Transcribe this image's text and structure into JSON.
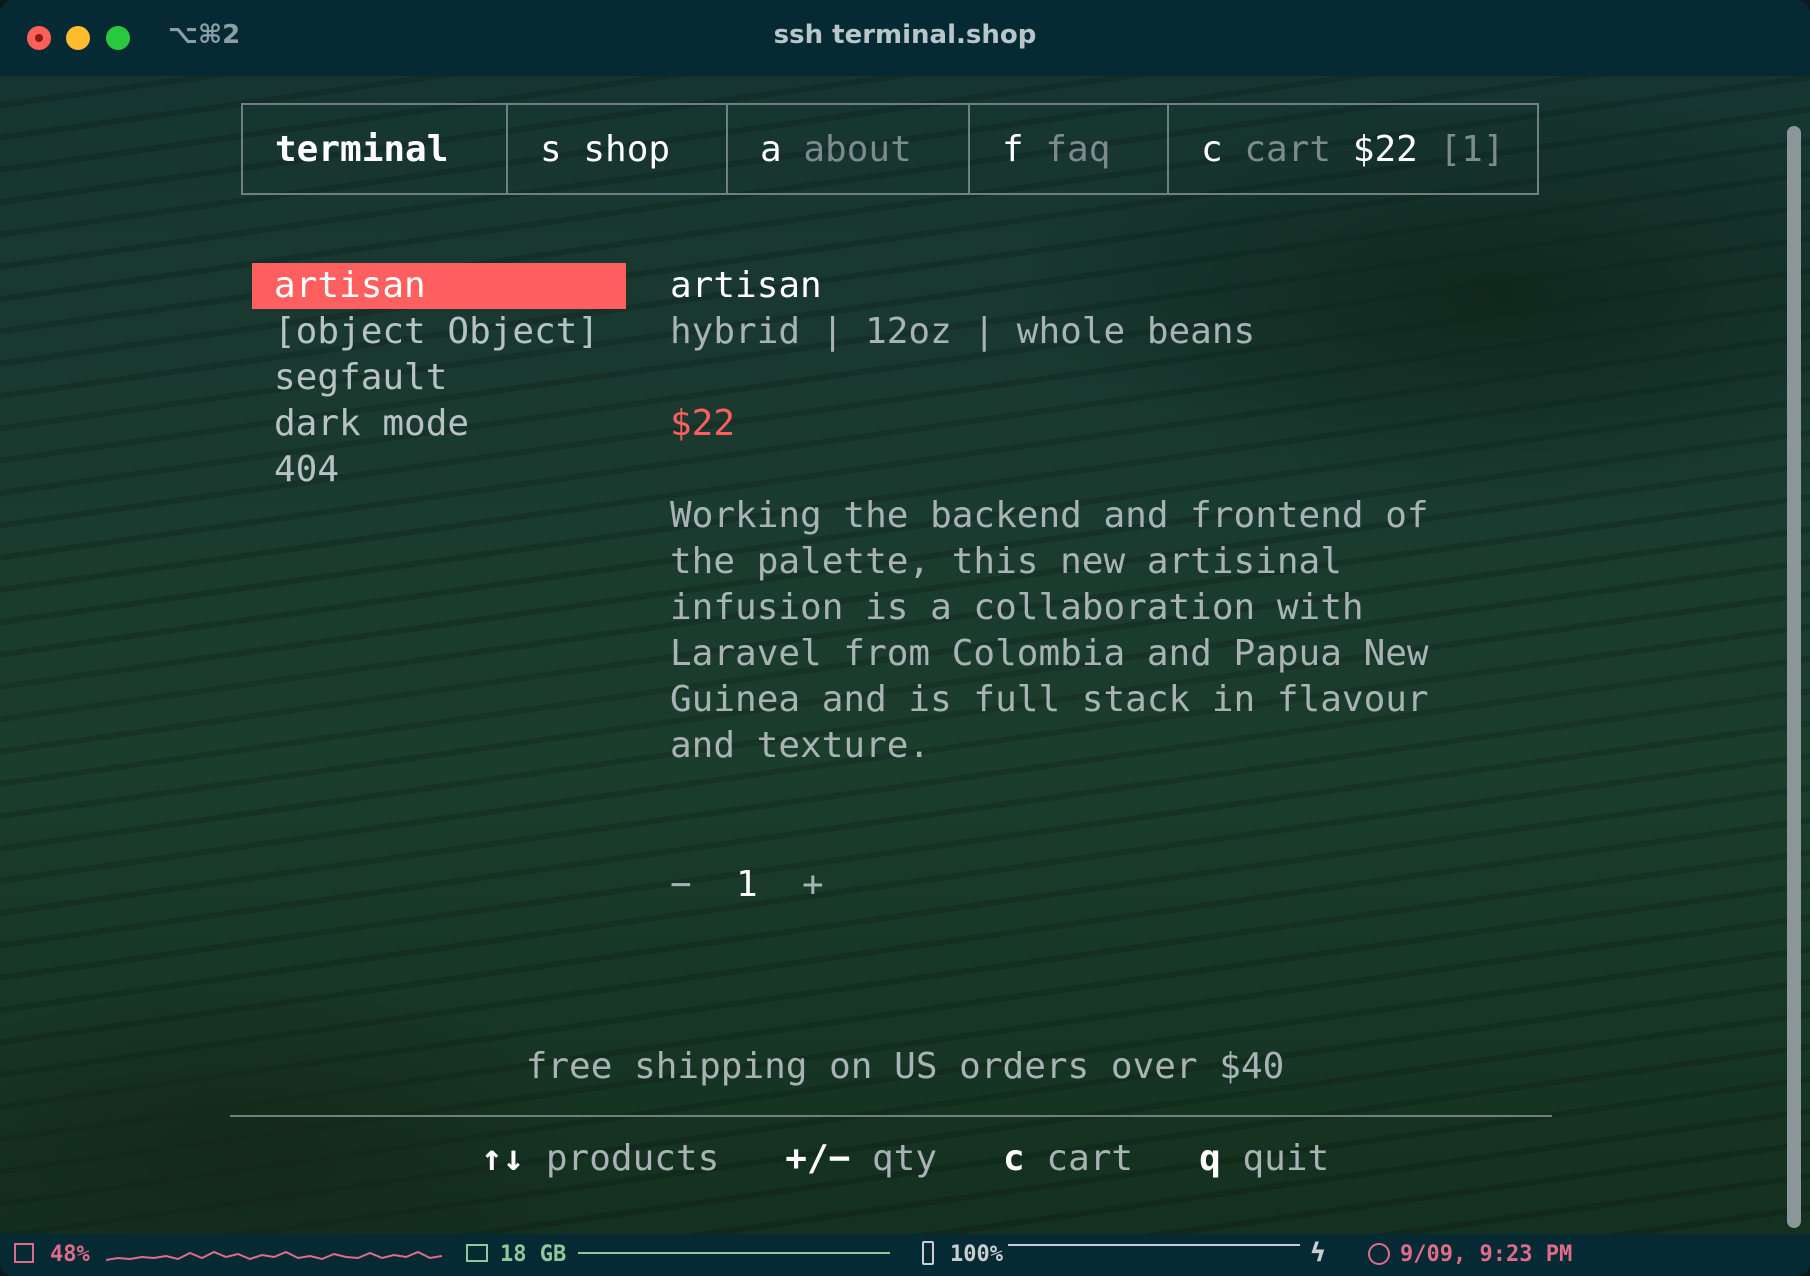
{
  "window": {
    "title": "ssh terminal.shop",
    "shortcut": "⌥⌘2"
  },
  "tabs": {
    "brand": "terminal",
    "shop": {
      "key": "s",
      "label": "shop"
    },
    "about": {
      "key": "a",
      "label": "about"
    },
    "faq": {
      "key": "f",
      "label": "faq"
    },
    "cart": {
      "key": "c",
      "label": "cart",
      "total": "$22",
      "count": "[1]"
    }
  },
  "products": {
    "items": [
      {
        "label": "artisan",
        "selected": true
      },
      {
        "label": "[object Object]"
      },
      {
        "label": "segfault"
      },
      {
        "label": "dark mode"
      },
      {
        "label": "404"
      }
    ]
  },
  "detail": {
    "name": "artisan",
    "meta": "hybrid | 12oz | whole beans",
    "price": "$22",
    "description_lines": [
      "Working the backend and frontend of",
      "the palette, this new artisinal",
      "infusion is a collaboration with",
      "Laravel from Colombia and Papua New",
      "Guinea and is full stack in flavour",
      "and texture."
    ],
    "quantity": {
      "minus": "−",
      "value": "1",
      "plus": "+"
    }
  },
  "shipping_note": "free shipping on US orders over $40",
  "help": [
    {
      "key": "↑↓",
      "desc": "products"
    },
    {
      "key": "+/−",
      "desc": "qty"
    },
    {
      "key": "c",
      "desc": "cart"
    },
    {
      "key": "q",
      "desc": "quit"
    }
  ],
  "statusbar": {
    "cpu": "48%",
    "memory": "18 GB",
    "battery": "100%",
    "datetime": "9/09, 9:23 PM",
    "icons": [
      "cpu-icon",
      "memory-icon",
      "battery-icon",
      "bolt-icon",
      "clock-icon"
    ]
  },
  "colors": {
    "accent": "#ff5f5f",
    "titlebar": "#062a33",
    "cpu": "#e06c8c",
    "memory": "#8fc99b"
  }
}
